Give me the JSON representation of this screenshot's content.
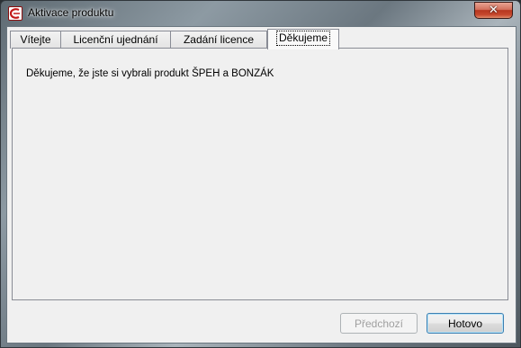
{
  "window": {
    "title": "Aktivace produktu",
    "close_glyph": "✕"
  },
  "tabs": [
    {
      "label": "Vítejte"
    },
    {
      "label": "Licenční ujednání"
    },
    {
      "label": "Zadání licence"
    },
    {
      "label": "Děkujeme"
    }
  ],
  "active_tab": "Děkujeme",
  "panel": {
    "message": "Děkujeme, že jste si vybrali produkt ŠPEH a BONZÁK"
  },
  "buttons": {
    "previous_label": "Předchozí",
    "finish_label": "Hotovo"
  },
  "icons": {
    "app": "app-logo-icon",
    "close": "close-icon"
  },
  "colors": {
    "close_button": "#c7492e",
    "default_button_border": "#3c7fb1"
  }
}
